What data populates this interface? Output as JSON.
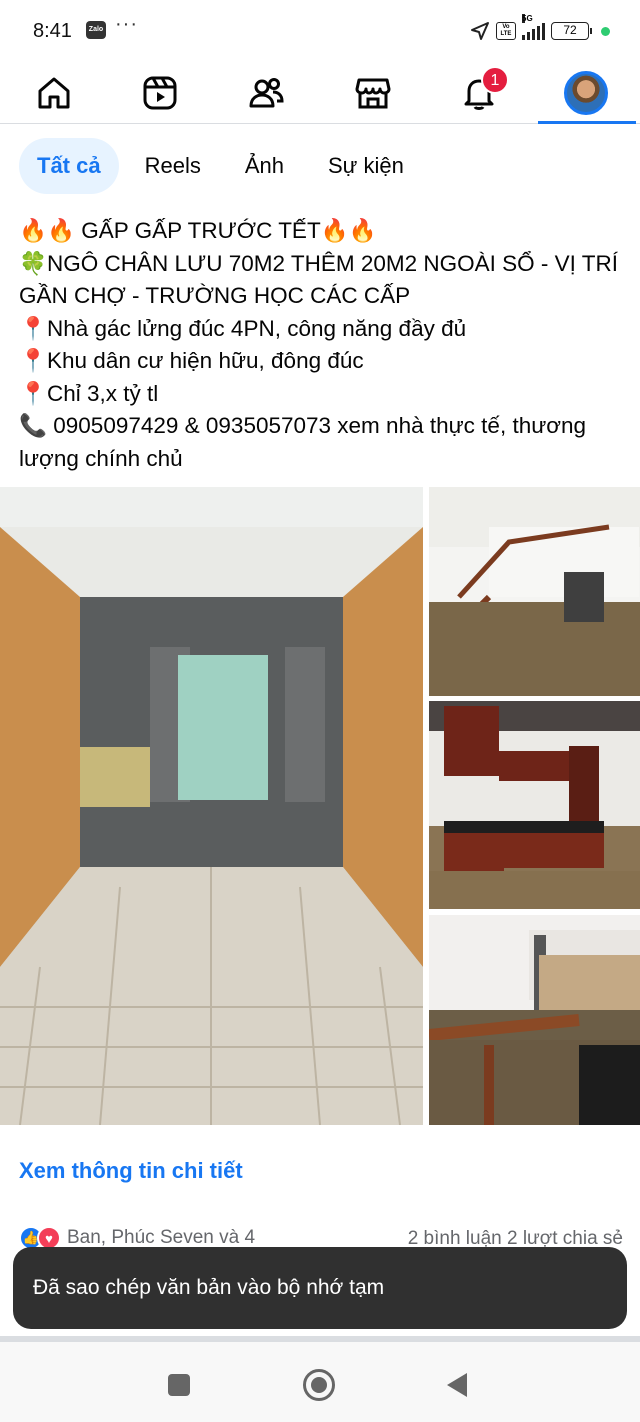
{
  "status": {
    "time": "8:41",
    "zalo": "Zalo",
    "dots": "···",
    "network": "5G",
    "volte": "Vo LTE",
    "battery": "72"
  },
  "nav": {
    "items": [
      "home-icon",
      "reels-icon",
      "friends-icon",
      "marketplace-icon",
      "notifications-icon",
      "profile-avatar"
    ],
    "notification_count": "1",
    "active": "profile"
  },
  "tabs": [
    {
      "label": "Tất cả",
      "active": true
    },
    {
      "label": "Reels",
      "active": false
    },
    {
      "label": "Ảnh",
      "active": false
    },
    {
      "label": "Sự kiện",
      "active": false
    }
  ],
  "post": {
    "lines": [
      "🔥🔥 GẤP GẤP TRƯỚC TẾT🔥🔥",
      "🍀NGÔ CHÂN LƯU 70M2 THÊM 20M2 NGOÀI SỔ - VỊ TRÍ GẦN CHỢ - TRƯỜNG HỌC CÁC CẤP",
      "📍Nhà gác lửng đúc 4PN, công năng đầy đủ",
      "📍Khu dân cư hiện hữu, đông đúc",
      "📍Chỉ 3,x tỷ tl",
      "📞 0905097429 & 0935057073 xem nhà thực tế, thương lượng chính chủ"
    ],
    "detail_link": "Xem thông tin chi tiết",
    "reactions_text": "Ban, Phúc Seven và 4",
    "comments_shares": "2 bình luận  2 lượt chia sẻ"
  },
  "toast": {
    "message": "Đã sao chép văn bản vào bộ nhớ tạm"
  },
  "colors": {
    "accent": "#1877f2",
    "badge": "#e41e3f",
    "toast_bg": "#303030"
  }
}
